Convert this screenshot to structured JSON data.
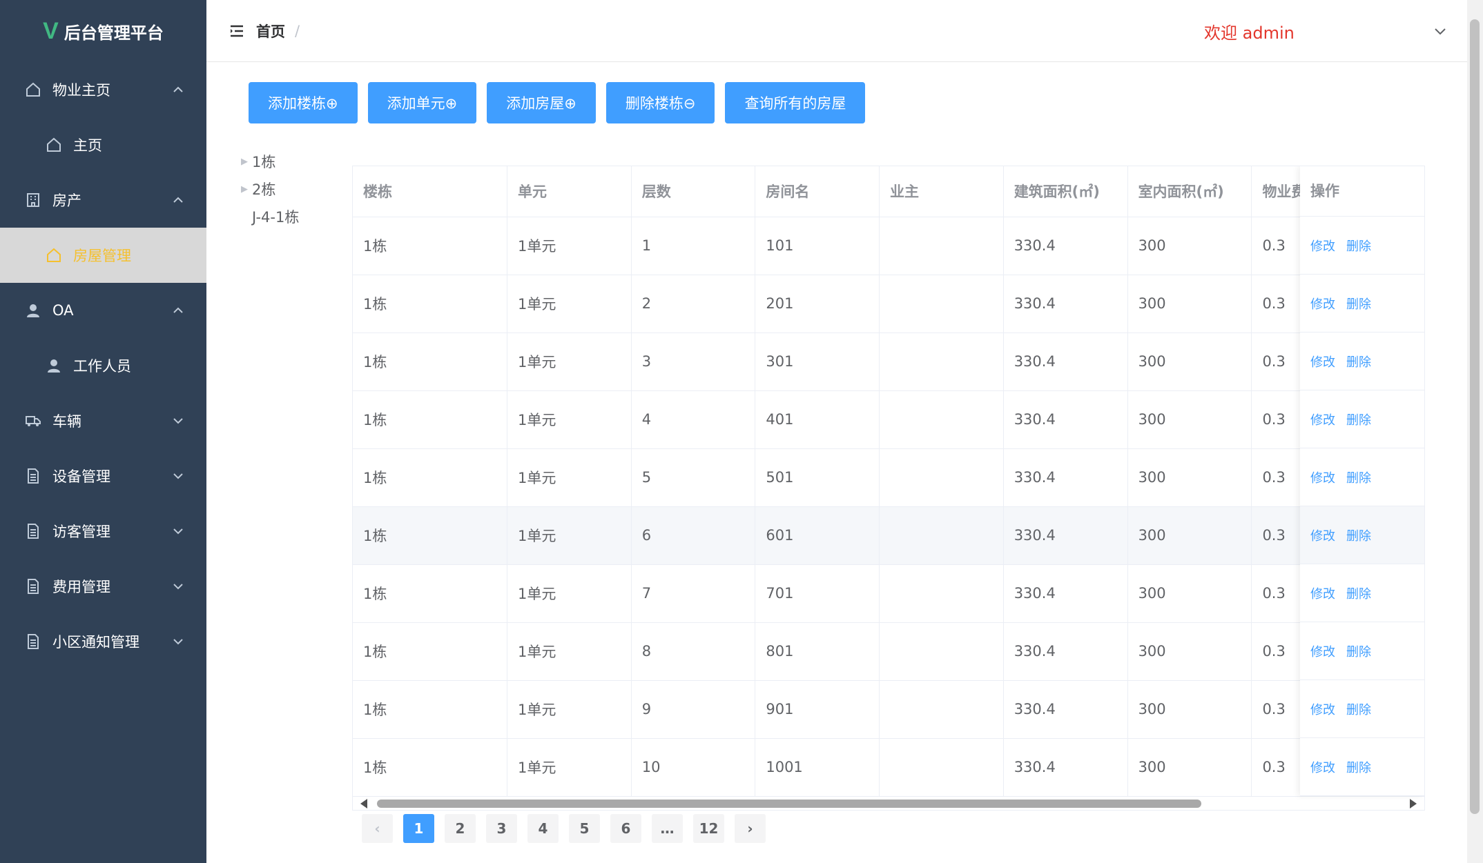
{
  "app": {
    "title": "后台管理平台"
  },
  "sidebar": {
    "items": [
      {
        "label": "物业主页",
        "icon": "home-icon"
      },
      {
        "label": "主页",
        "icon": "home-icon"
      },
      {
        "label": "房产",
        "icon": "building-icon"
      },
      {
        "label": "房屋管理",
        "icon": "home-icon"
      },
      {
        "label": "OA",
        "icon": "user-icon"
      },
      {
        "label": "工作人员",
        "icon": "user-icon"
      },
      {
        "label": "车辆",
        "icon": "truck-icon"
      },
      {
        "label": "设备管理",
        "icon": "document-icon"
      },
      {
        "label": "访客管理",
        "icon": "document-icon"
      },
      {
        "label": "费用管理",
        "icon": "document-icon"
      },
      {
        "label": "小区通知管理",
        "icon": "document-icon"
      }
    ]
  },
  "header": {
    "breadcrumb": "首页",
    "separator": "/",
    "welcome": "欢迎 admin"
  },
  "toolbar": {
    "buttons": [
      "添加楼栋⊕",
      "添加单元⊕",
      "添加房屋⊕",
      "删除楼栋⊖",
      "查询所有的房屋"
    ]
  },
  "tree": {
    "nodes": [
      "1栋",
      "2栋",
      "J-4-1栋"
    ]
  },
  "table": {
    "columns": [
      "楼栋",
      "单元",
      "层数",
      "房间名",
      "业主",
      "建筑面积(㎡)",
      "室内面积(㎡)",
      "物业费",
      "操作"
    ],
    "rows": [
      [
        "1栋",
        "1单元",
        "1",
        "101",
        "",
        "330.4",
        "300",
        "0.3"
      ],
      [
        "1栋",
        "1单元",
        "2",
        "201",
        "",
        "330.4",
        "300",
        "0.3"
      ],
      [
        "1栋",
        "1单元",
        "3",
        "301",
        "",
        "330.4",
        "300",
        "0.3"
      ],
      [
        "1栋",
        "1单元",
        "4",
        "401",
        "",
        "330.4",
        "300",
        "0.3"
      ],
      [
        "1栋",
        "1单元",
        "5",
        "501",
        "",
        "330.4",
        "300",
        "0.3"
      ],
      [
        "1栋",
        "1单元",
        "6",
        "601",
        "",
        "330.4",
        "300",
        "0.3"
      ],
      [
        "1栋",
        "1单元",
        "7",
        "701",
        "",
        "330.4",
        "300",
        "0.3"
      ],
      [
        "1栋",
        "1单元",
        "8",
        "801",
        "",
        "330.4",
        "300",
        "0.3"
      ],
      [
        "1栋",
        "1单元",
        "9",
        "901",
        "",
        "330.4",
        "300",
        "0.3"
      ],
      [
        "1栋",
        "1单元",
        "10",
        "1001",
        "",
        "330.4",
        "300",
        "0.3"
      ]
    ],
    "action_edit": "修改",
    "action_delete": "删除"
  },
  "pagination": {
    "pages": [
      "1",
      "2",
      "3",
      "4",
      "5",
      "6",
      "…",
      "12"
    ],
    "current": "1",
    "prev": "‹",
    "next": "›"
  },
  "colors": {
    "sidebar_bg": "#304156",
    "accent": "#409eff",
    "active_text": "#f5c02e",
    "welcome": "#e3362c"
  }
}
